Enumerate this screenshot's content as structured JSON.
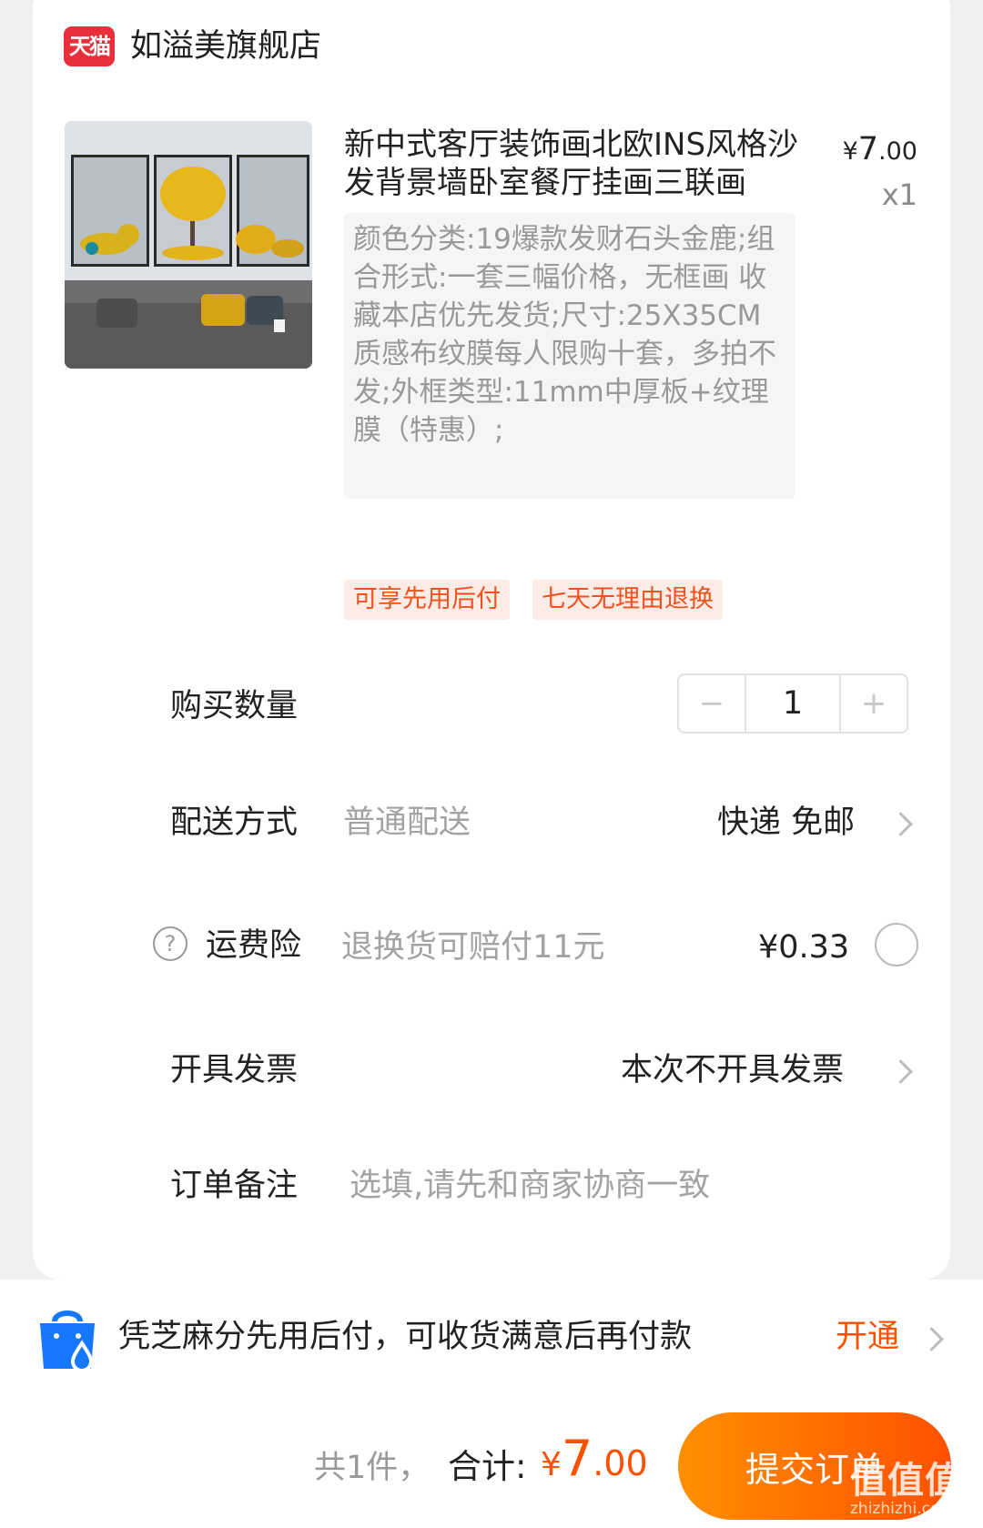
{
  "store": {
    "badge": "天猫",
    "name": "如溢美旗舰店"
  },
  "product": {
    "title": "新中式客厅装饰画北欧INS风格沙发背景墙卧室餐厅挂画三联画",
    "price_symbol": "¥",
    "price_int": "7",
    "price_dec": ".00",
    "quantity_label": "x1",
    "sku": "颜色分类:19爆款发财石头金鹿;组合形式:一套三幅价格，无框画 收藏本店优先发货;尺寸:25X35CM质感布纹膜每人限购十套，多拍不发;外框类型:11mm中厚板+纹理膜（特惠）;",
    "tags": [
      "可享先用后付",
      "七天无理由退换"
    ]
  },
  "quantity": {
    "label": "购买数量",
    "value": "1",
    "minus": "−",
    "plus": "+"
  },
  "delivery": {
    "label": "配送方式",
    "method": "普通配送",
    "value": "快递 免邮"
  },
  "insurance": {
    "help": "?",
    "label": "运费险",
    "desc": "退换货可赔付11元",
    "price": "¥0.33"
  },
  "invoice": {
    "label": "开具发票",
    "value": "本次不开具发票"
  },
  "remark": {
    "label": "订单备注",
    "placeholder": "选填,请先和商家协商一致"
  },
  "pay_later": {
    "text": "凭芝麻分先用后付，可收货满意后再付款",
    "action": "开通"
  },
  "footer": {
    "count": "共1件，",
    "total_label": "合计:",
    "total_symbol": "¥",
    "total_int": "7",
    "total_dec": ".00",
    "submit": "提交订单",
    "watermark": "值值值",
    "watermark_sub": "zhizhizhi.com"
  },
  "colors": {
    "accent": "#ff5000",
    "gradient_start": "#ff9000",
    "badge_red": "#e8303a",
    "tag_bg": "#fdece6"
  },
  "icons": [
    "help-icon",
    "chevron-right-icon",
    "radio-unchecked-icon",
    "shopping-bag-icon"
  ]
}
